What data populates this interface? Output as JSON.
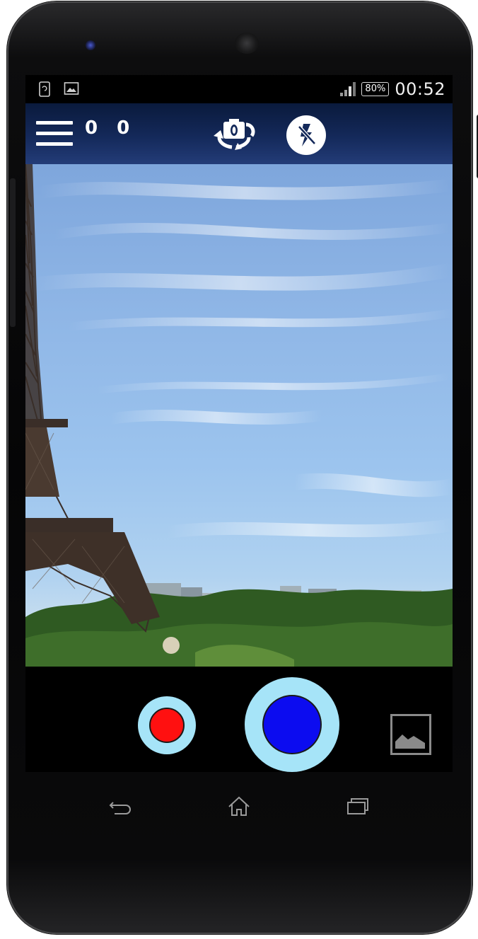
{
  "status_bar": {
    "battery": "80%",
    "time": "00:52",
    "icons": [
      "screenshot-icon",
      "gallery-notification-icon",
      "signal-icon",
      "battery-icon"
    ]
  },
  "top_bar": {
    "counter": "0 0",
    "icons": [
      "menu-icon",
      "switch-camera-icon",
      "flash-off-icon"
    ]
  },
  "viewfinder": {
    "scene": "eiffel-tower-sky"
  },
  "controls": {
    "video_color": "#ff1010",
    "shutter_color": "#0c0cf0",
    "ring_color": "#a6e4f8",
    "icons": [
      "record-video-icon",
      "shutter-icon",
      "gallery-icon"
    ]
  },
  "nav_bar": {
    "icons": [
      "back-icon",
      "home-icon",
      "recents-icon"
    ]
  }
}
